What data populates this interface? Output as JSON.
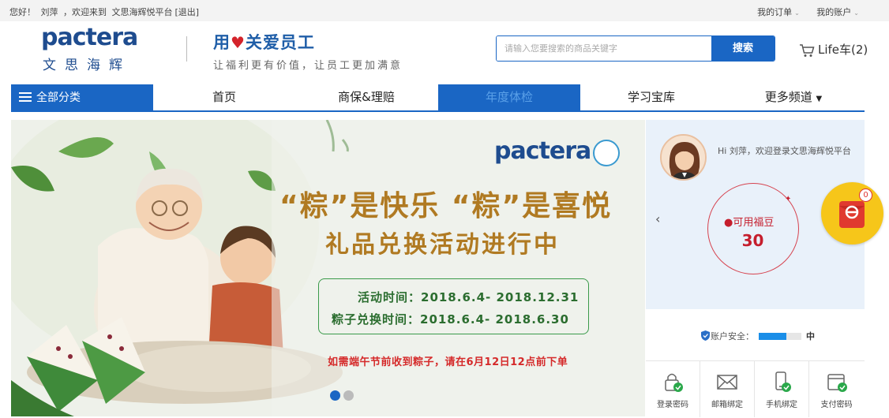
{
  "topbar": {
    "greeting": "您好！",
    "username": "刘萍",
    "welcome": "，欢迎来到",
    "platform": "文思海辉悦平台",
    "logout": "[退出]",
    "my_orders": "我的订单",
    "my_account": "我的账户"
  },
  "header": {
    "logo_brand": "pactera",
    "logo_cn": "文思海辉",
    "slogan_main_pre": "用",
    "slogan_main_post": "关爱员工",
    "slogan_sub": "让福利更有价值，让员工更加满意",
    "search_placeholder": "请输入您要搜索的商品关键字",
    "search_button": "搜索",
    "cart_label": "Life车(2)"
  },
  "nav": {
    "all_categories": "全部分类",
    "tabs": [
      {
        "label": "首页"
      },
      {
        "label": "商保&理赔"
      },
      {
        "label": "年度体检"
      },
      {
        "label": "学习宝库"
      },
      {
        "label": "更多频道"
      }
    ],
    "more_caret": "▼"
  },
  "banner": {
    "logo_brand": "pactera",
    "headline": "“粽”是快乐 “粽”是喜悦",
    "subheadline": "礼品兑换活动进行中",
    "activity_time": "活动时间：2018.6.4- 2018.12.31",
    "exchange_time": "粽子兑换时间：2018.6.4- 2018.6.30",
    "note": "如需端午节前收到粽子，请在6月12日12点前下单",
    "slides_total": 2,
    "slide_active": 1
  },
  "panel": {
    "hi_text": "Hi 刘萍，欢迎登录文思海辉悦平台",
    "prev_arrow": "‹",
    "fudou_label": "可用福豆",
    "fudou_value": "30",
    "security_label": "账户安全：",
    "security_level": "中",
    "security_fraction": 0.65,
    "shortcuts": [
      {
        "label": "登录密码",
        "icon": "lock-icon"
      },
      {
        "label": "邮箱绑定",
        "icon": "mail-icon"
      },
      {
        "label": "手机绑定",
        "icon": "phone-icon"
      },
      {
        "label": "支付密码",
        "icon": "wallet-icon"
      }
    ]
  },
  "float_badge": {
    "count": "0"
  },
  "colors": {
    "brand_blue": "#1a66c4",
    "accent_red": "#c51e2d",
    "badge_yellow": "#f6c61a"
  }
}
